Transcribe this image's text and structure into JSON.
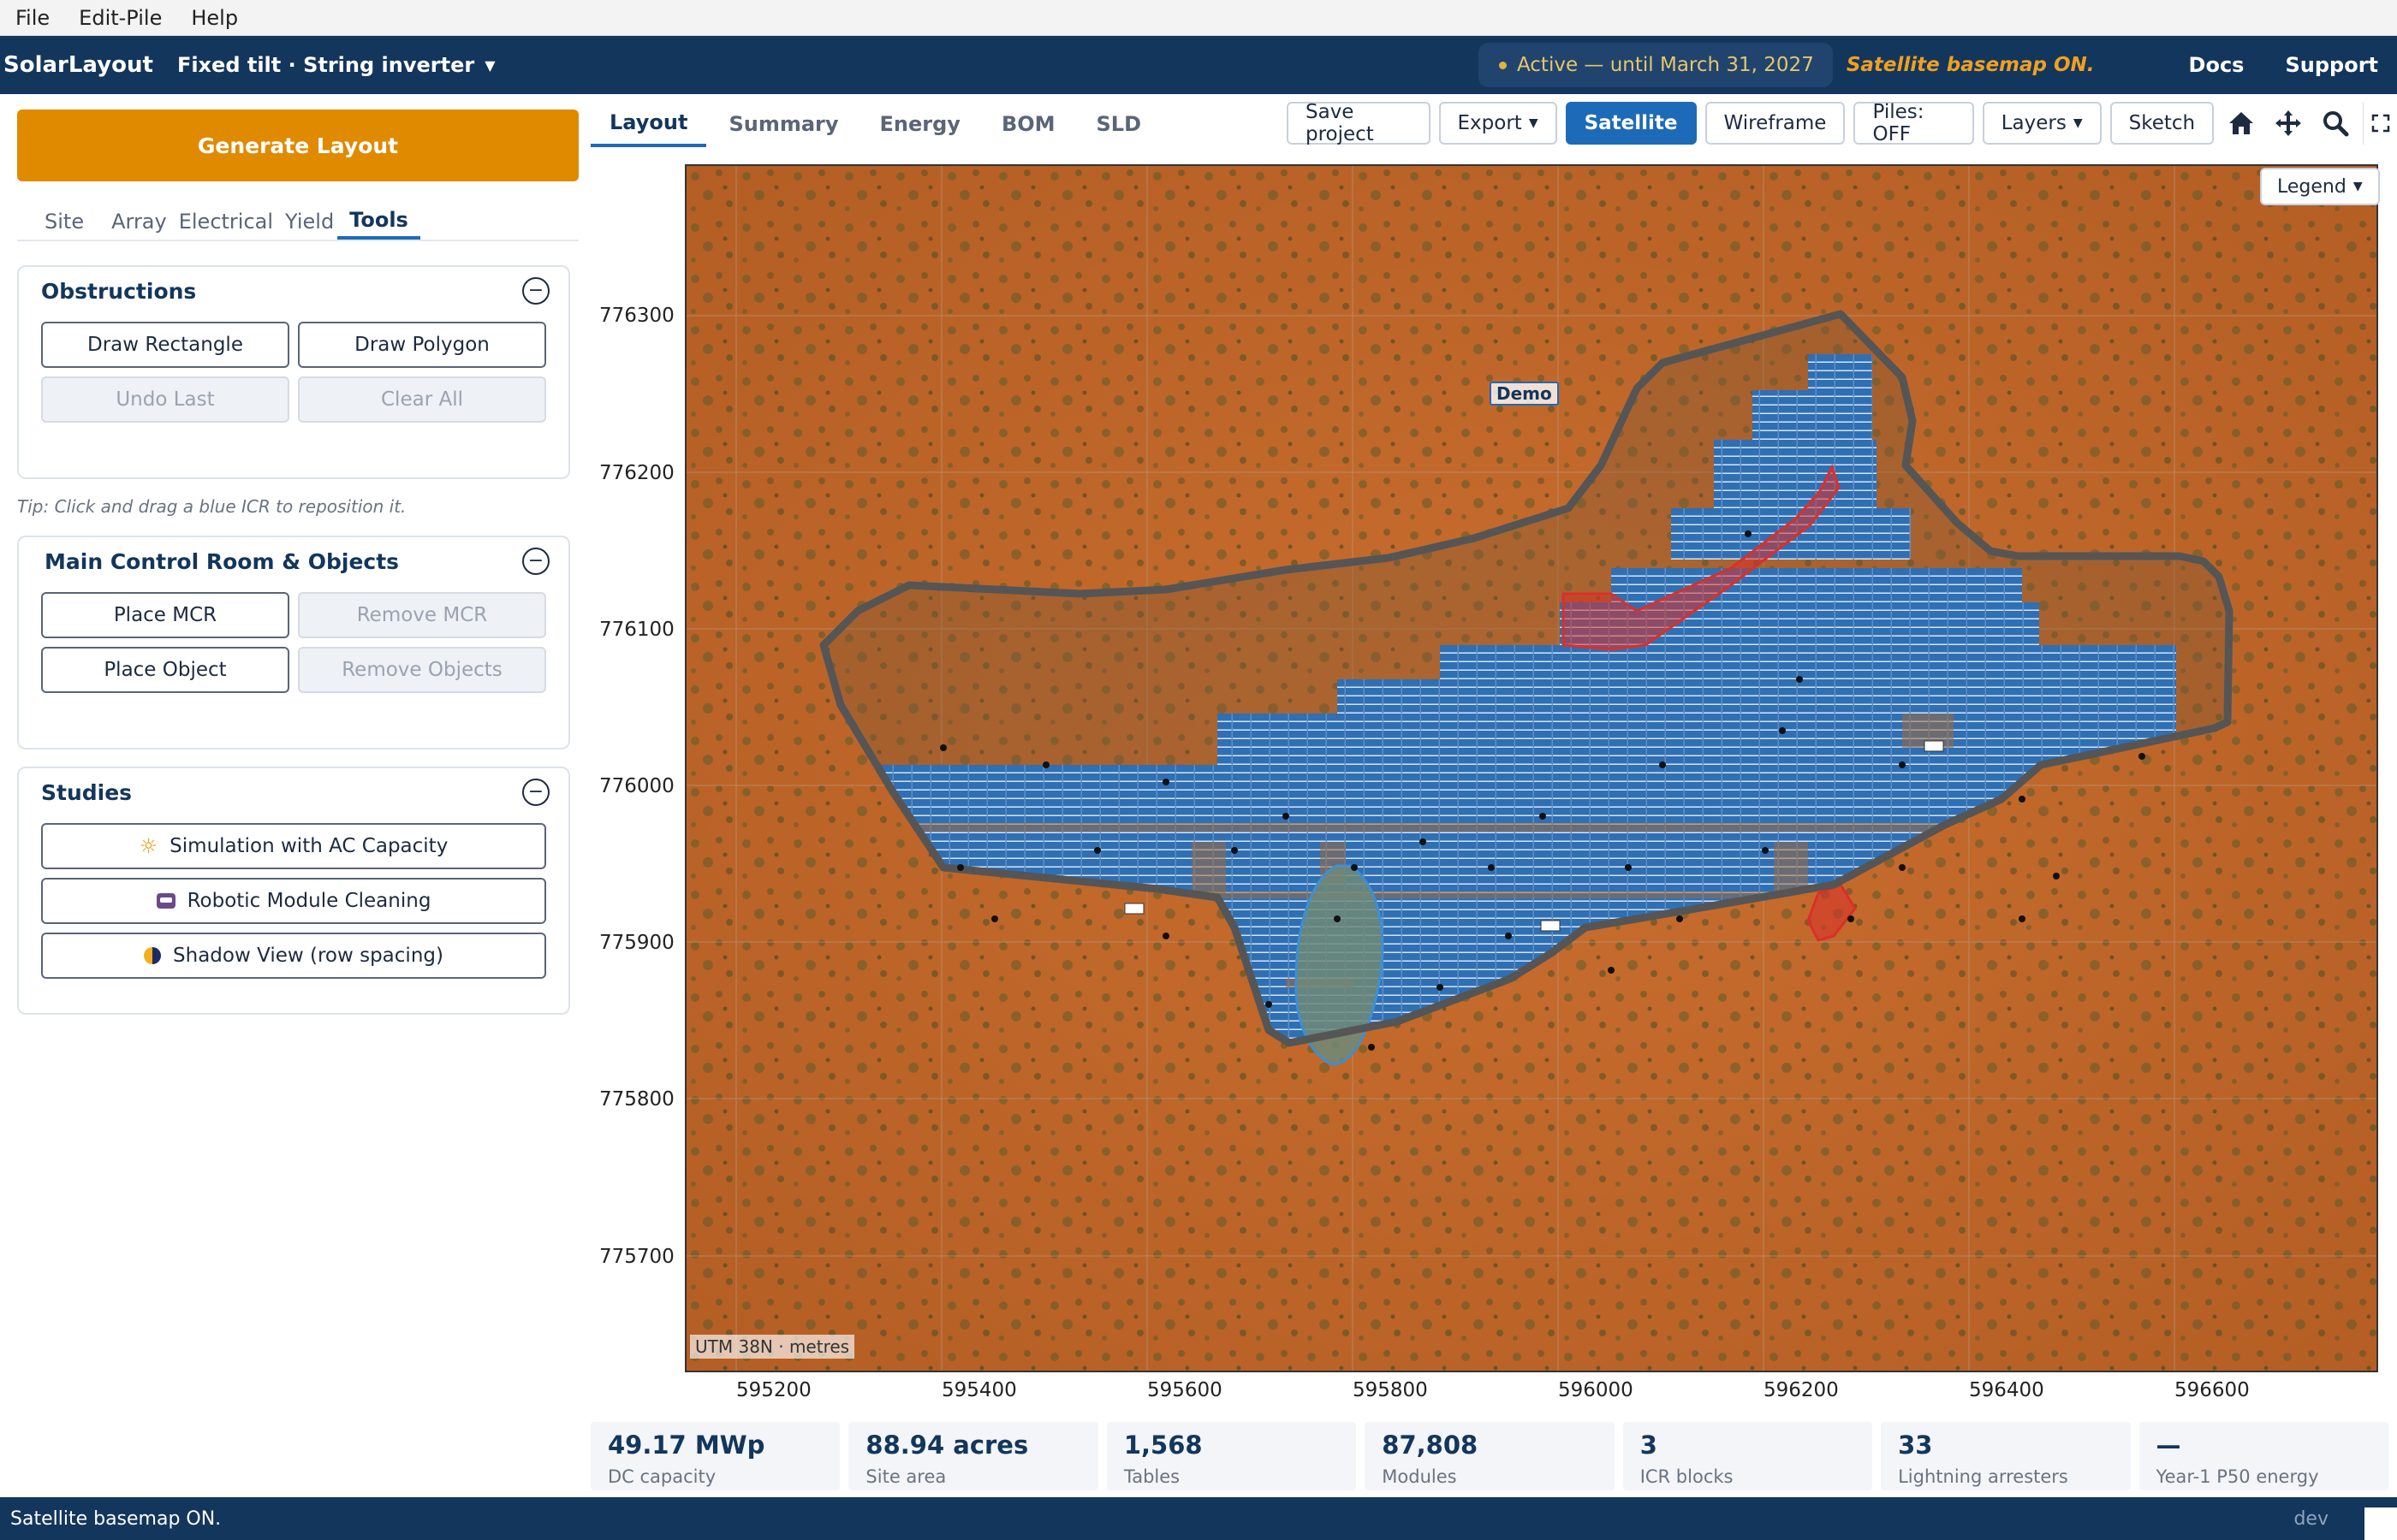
{
  "menu": {
    "items": [
      "File",
      "Edit-Pile",
      "Help"
    ]
  },
  "app": {
    "title": "SolarLayout",
    "mode": "Fixed tilt · String inverter",
    "status": "Active — until March 31, 2027",
    "satellite_notice": "Satellite basemap ON.",
    "links": {
      "docs": "Docs",
      "support": "Support"
    }
  },
  "sidebar": {
    "generate_label": "Generate Layout",
    "tabs": [
      "Site",
      "Array",
      "Electrical",
      "Yield",
      "Tools"
    ],
    "active_tab": "Tools",
    "obstructions": {
      "title": "Obstructions",
      "draw_rectangle": "Draw Rectangle",
      "draw_polygon": "Draw Polygon",
      "undo_last": "Undo Last",
      "clear_all": "Clear All"
    },
    "tip": "Tip: Click and drag a blue ICR to reposition it.",
    "mcr": {
      "title": "Main Control Room & Objects",
      "place_mcr": "Place MCR",
      "remove_mcr": "Remove MCR",
      "place_object": "Place Object",
      "remove_objects": "Remove Objects"
    },
    "studies": {
      "title": "Studies",
      "items": [
        "Simulation with AC Capacity",
        "Robotic Module Cleaning",
        "Shadow View (row spacing)"
      ]
    }
  },
  "main_tabs": [
    "Layout",
    "Summary",
    "Energy",
    "BOM",
    "SLD"
  ],
  "active_main_tab": "Layout",
  "toolbar": {
    "save": "Save project",
    "export": "Export",
    "satellite": "Satellite",
    "wireframe": "Wireframe",
    "piles": "Piles: OFF",
    "layers": "Layers",
    "sketch": "Sketch"
  },
  "map": {
    "legend": "Legend",
    "demo_label": "Demo",
    "crs_label": "UTM 38N · metres",
    "y_ticks": [
      "776300",
      "776200",
      "776100",
      "776000",
      "775900",
      "775800",
      "775700"
    ],
    "x_ticks": [
      "595200",
      "595400",
      "595600",
      "595800",
      "596000",
      "596200",
      "596400",
      "596600"
    ],
    "colors": {
      "panel": "#2f6fb4",
      "boundary": "#555555",
      "obstruction": "#d9302a",
      "pond": "#3d8fd0",
      "ground": "#c2692a"
    }
  },
  "stats": [
    {
      "value": "49.17 MWp",
      "label": "DC capacity"
    },
    {
      "value": "88.94 acres",
      "label": "Site area"
    },
    {
      "value": "1,568",
      "label": "Tables"
    },
    {
      "value": "87,808",
      "label": "Modules"
    },
    {
      "value": "3",
      "label": "ICR blocks"
    },
    {
      "value": "33",
      "label": "Lightning arresters"
    },
    {
      "value": "—",
      "label": "Year-1 P50 energy"
    }
  ],
  "statusbar": {
    "message": "Satellite basemap ON.",
    "env": "dev"
  }
}
